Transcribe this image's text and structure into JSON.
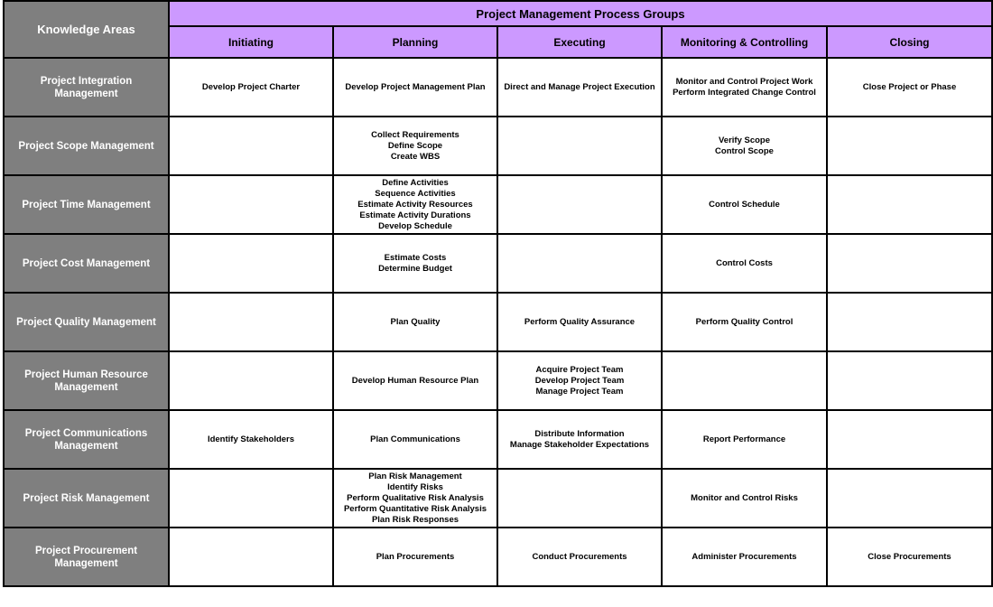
{
  "header": {
    "knowledge_areas_label": "Knowledge Areas",
    "process_groups_title": "Project Management Process Groups",
    "process_groups": [
      "Initiating",
      "Planning",
      "Executing",
      "Monitoring & Controlling",
      "Closing"
    ]
  },
  "colors": {
    "header_purple": "#cc99ff",
    "knowledge_area_gray": "#7f7f7f",
    "border": "#000000"
  },
  "rows": [
    {
      "area": "Project Integration Management",
      "cells": [
        [
          "Develop Project Charter"
        ],
        [
          "Develop Project Management Plan"
        ],
        [
          "Direct and Manage Project Execution"
        ],
        [
          "Monitor and Control Project Work",
          "Perform Integrated Change Control"
        ],
        [
          "Close Project or Phase"
        ]
      ]
    },
    {
      "area": "Project Scope Management",
      "cells": [
        [],
        [
          "Collect Requirements",
          "Define Scope",
          "Create WBS"
        ],
        [],
        [
          "Verify Scope",
          "Control Scope"
        ],
        []
      ]
    },
    {
      "area": "Project Time Management",
      "cells": [
        [],
        [
          "Define Activities",
          "Sequence Activities",
          "Estimate Activity Resources",
          "Estimate Activity Durations",
          "Develop Schedule"
        ],
        [],
        [
          "Control Schedule"
        ],
        []
      ]
    },
    {
      "area": "Project Cost Management",
      "cells": [
        [],
        [
          "Estimate Costs",
          "Determine Budget"
        ],
        [],
        [
          "Control Costs"
        ],
        []
      ]
    },
    {
      "area": "Project Quality Management",
      "cells": [
        [],
        [
          "Plan Quality"
        ],
        [
          "Perform Quality Assurance"
        ],
        [
          "Perform Quality Control"
        ],
        []
      ]
    },
    {
      "area": "Project Human Resource Management",
      "cells": [
        [],
        [
          "Develop Human Resource Plan"
        ],
        [
          "Acquire Project Team",
          "Develop Project Team",
          "Manage Project Team"
        ],
        [],
        []
      ]
    },
    {
      "area": "Project Communications Management",
      "cells": [
        [
          "Identify Stakeholders"
        ],
        [
          "Plan Communications"
        ],
        [
          "Distribute Information",
          "Manage Stakeholder Expectations"
        ],
        [
          "Report Performance"
        ],
        []
      ]
    },
    {
      "area": "Project Risk Management",
      "cells": [
        [],
        [
          "Plan Risk Management",
          "Identify Risks",
          "Perform Qualitative Risk Analysis",
          "Perform Quantitative Risk Analysis",
          "Plan Risk Responses"
        ],
        [],
        [
          "Monitor and Control Risks"
        ],
        []
      ]
    },
    {
      "area": "Project Procurement Management",
      "cells": [
        [],
        [
          "Plan Procurements"
        ],
        [
          "Conduct Procurements"
        ],
        [
          "Administer Procurements"
        ],
        [
          "Close Procurements"
        ]
      ]
    }
  ]
}
